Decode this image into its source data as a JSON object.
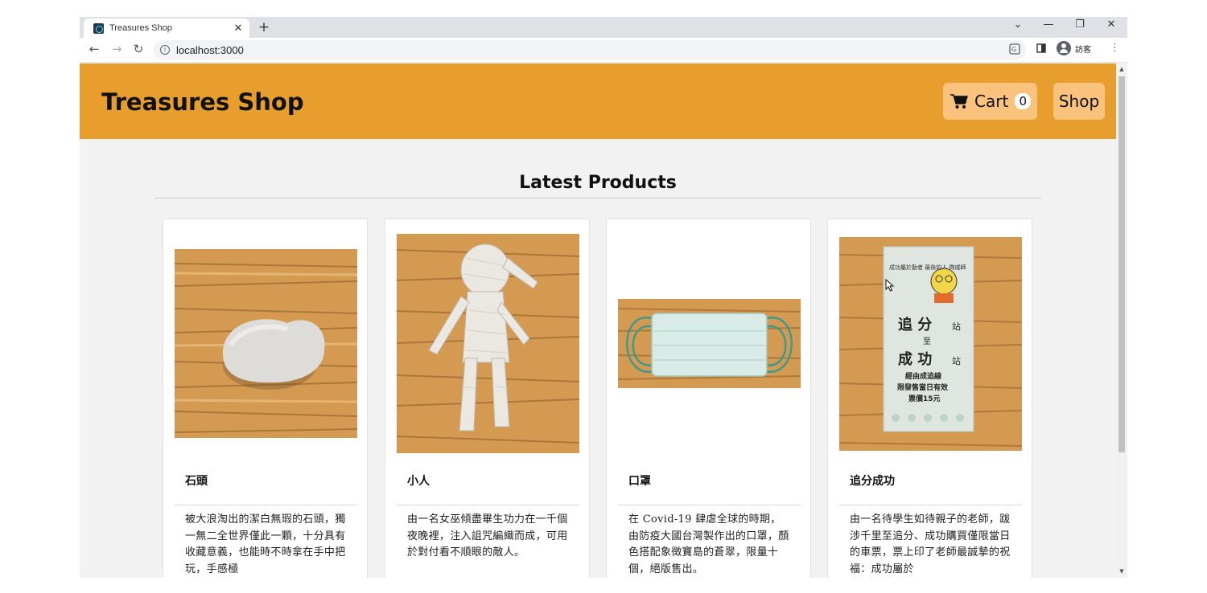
{
  "browser": {
    "tab_title": "Treasures Shop",
    "url": "localhost:3000",
    "profile_label": "訪客"
  },
  "site": {
    "brand": "Treasures Shop",
    "cart_label": "Cart",
    "cart_count": "0",
    "shop_label": "Shop"
  },
  "section": {
    "title": "Latest Products"
  },
  "products": [
    {
      "name": "石頭",
      "description": "被大浪淘出的潔白無瑕的石頭，獨一無二全世界僅此一顆，十分具有收藏意義，也能時不時拿在手中把玩，手感極"
    },
    {
      "name": "小人",
      "description": "由一名女巫傾盡畢生功力在一千個夜晚裡，注入詛咒編織而成，可用於對付看不順眼的敵人。"
    },
    {
      "name": "口罩",
      "description": "在 Covid-19 肆虐全球的時期，由防疫大國台灣製作出的口罩，顏色搭配象徵寶島的蒼翠，限量十個，絕版售出。"
    },
    {
      "name": "追分成功",
      "description": "由一名待學生如待親子的老師，跋涉千里至追分、成功購買僅限當日的車票，票上印了老師最誠摯的祝福：成功屬於",
      "ticket_text": {
        "top": "成功屬於勤者 最後的人 徵戚師",
        "from": "追 分",
        "station": "站",
        "to_word": "至",
        "dest": "成 功",
        "via": "經由成追線",
        "valid": "限發售當日有效",
        "price": "票價15元"
      }
    }
  ],
  "colors": {
    "header": "#e89e2d",
    "button": "#f9c27d",
    "page_bg": "#f2f2f2",
    "wood": "#d9a35c"
  }
}
